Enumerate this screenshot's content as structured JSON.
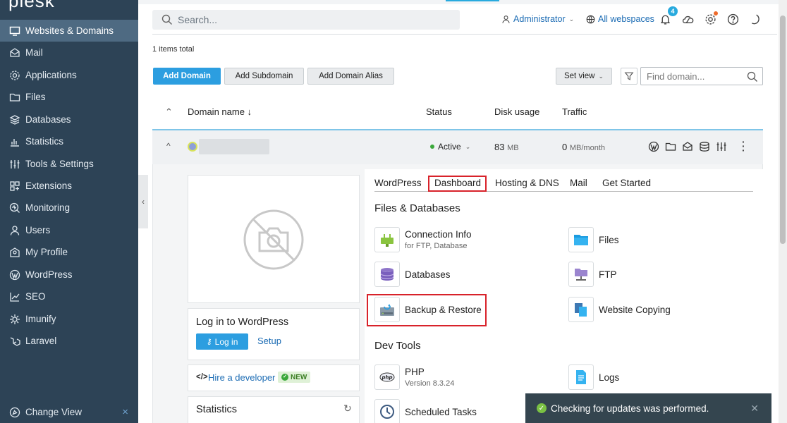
{
  "sidebar": {
    "logo": "plesk",
    "items": [
      {
        "label": "Websites & Domains",
        "icon": "monitor-icon",
        "active": true
      },
      {
        "label": "Mail",
        "icon": "mail-icon"
      },
      {
        "label": "Applications",
        "icon": "gear-icon"
      },
      {
        "label": "Files",
        "icon": "folder-icon"
      },
      {
        "label": "Databases",
        "icon": "database-icon"
      },
      {
        "label": "Statistics",
        "icon": "bar-chart-icon"
      },
      {
        "label": "Tools & Settings",
        "icon": "sliders-icon"
      },
      {
        "label": "Extensions",
        "icon": "extensions-icon"
      },
      {
        "label": "Monitoring",
        "icon": "monitoring-icon"
      },
      {
        "label": "Users",
        "icon": "user-icon"
      },
      {
        "label": "My Profile",
        "icon": "profile-icon"
      },
      {
        "label": "WordPress",
        "icon": "wordpress-icon"
      },
      {
        "label": "SEO",
        "icon": "seo-icon"
      },
      {
        "label": "Imunify",
        "icon": "imunify-icon"
      },
      {
        "label": "Laravel",
        "icon": "laravel-icon"
      }
    ],
    "change_view": "Change View",
    "collapse": "‹"
  },
  "header": {
    "search_placeholder": "Search...",
    "user": "Administrator",
    "webspaces": "All webspaces",
    "notification_count": "4"
  },
  "toolbar": {
    "items_total": "1 items total",
    "add_domain": "Add Domain",
    "add_subdomain": "Add Subdomain",
    "add_domain_alias": "Add Domain Alias",
    "set_view": "Set view",
    "find_placeholder": "Find domain..."
  },
  "table": {
    "col_domain": "Domain name ↓",
    "col_status": "Status",
    "col_disk": "Disk usage",
    "col_traffic": "Traffic",
    "row": {
      "status": "Active",
      "disk_value": "83",
      "disk_unit": "MB",
      "traffic_value": "0",
      "traffic_unit": "MB/month"
    }
  },
  "left_panel": {
    "wp_title": "Log in to WordPress",
    "login_button": "Log in",
    "setup_link": "Setup",
    "hire_link": "Hire a developer",
    "new_badge": "NEW",
    "stats_title": "Statistics"
  },
  "tabs": [
    "WordPress",
    "Dashboard",
    "Hosting & DNS",
    "Mail",
    "Get Started"
  ],
  "sections": {
    "files_db": "Files & Databases",
    "dev_tools": "Dev Tools"
  },
  "tools": {
    "connection_info": "Connection Info",
    "connection_info_sub": "for FTP, Database",
    "files": "Files",
    "databases": "Databases",
    "ftp": "FTP",
    "backup": "Backup & Restore",
    "website_copying": "Website Copying",
    "php": "PHP",
    "php_sub": "Version 8.3.24",
    "logs": "Logs",
    "scheduled_tasks": "Scheduled Tasks"
  },
  "toast": {
    "message": "Checking for updates was performed."
  },
  "colors": {
    "sidebar_bg": "#2d4356",
    "accent": "#2c9ee0",
    "highlight": "#d8222a",
    "active_green": "#3aa83a"
  }
}
